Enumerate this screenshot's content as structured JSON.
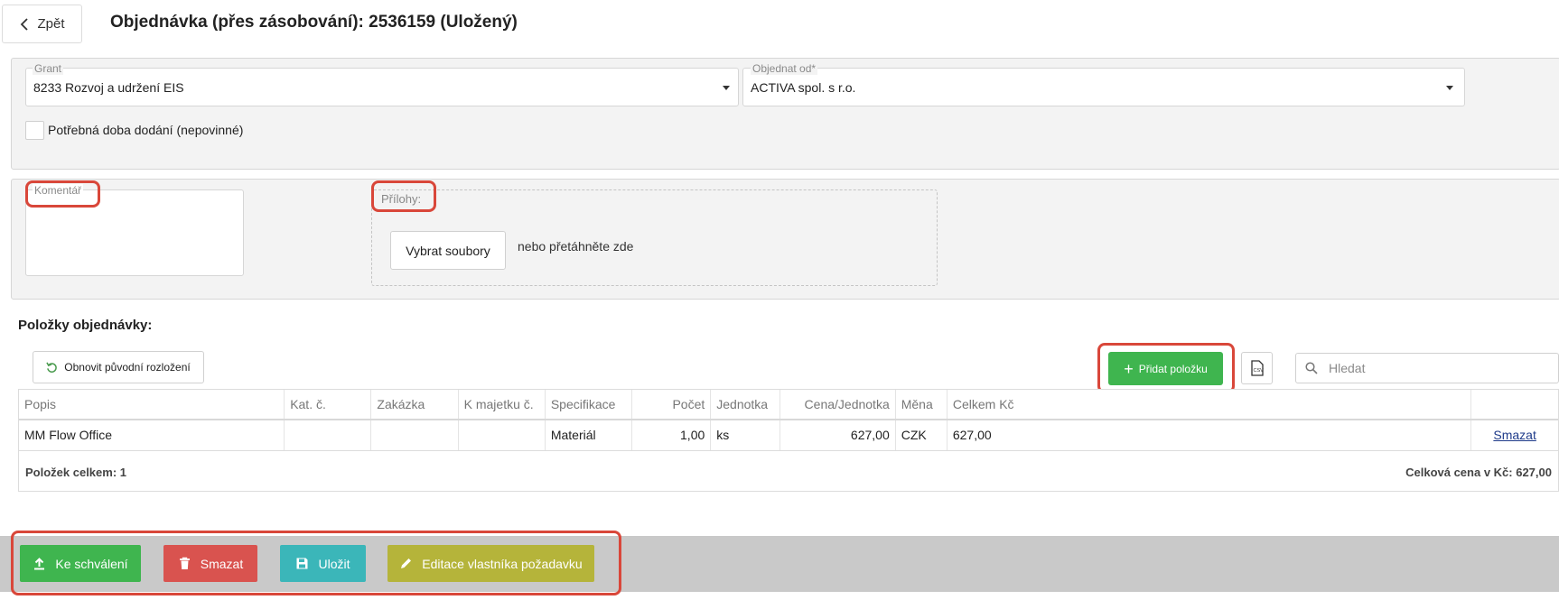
{
  "header": {
    "back_label": "Zpět",
    "title": "Objednávka (přes zásobování): 2536159 (Uložený)"
  },
  "order_form": {
    "grant": {
      "label": "Grant",
      "value": "8233 Rozvoj a udržení EIS"
    },
    "order_from": {
      "label": "Objednat od*",
      "value": "ACTIVA spol. s r.o."
    },
    "delivery_time_label": "Potřebná doba dodání (nepovinné)",
    "delivery_time_checked": false
  },
  "comment": {
    "label": "Komentář",
    "value": ""
  },
  "attachments": {
    "label": "Přílohy:",
    "select_button": "Vybrat soubory",
    "drop_hint": "nebo přetáhněte zde"
  },
  "items_section": {
    "title": "Položky objednávky:",
    "reset_layout_label": "Obnovit původní rozložení",
    "add_item_label": "Přidat položku",
    "csv_icon": "csv-export-icon",
    "search_placeholder": "Hledat",
    "columns": [
      "Popis",
      "Kat. č.",
      "Zakázka",
      "K majetku č.",
      "Specifikace",
      "Počet",
      "Jednotka",
      "Cena/Jednotka",
      "Měna",
      "Celkem Kč",
      ""
    ],
    "rows": [
      {
        "popis": "MM Flow Office",
        "kat_c": "",
        "zakazka": "",
        "k_majetku": "",
        "specifikace": "Materiál",
        "pocet": "1,00",
        "jednotka": "ks",
        "cena_jednotka": "627,00",
        "mena": "CZK",
        "celkem_kc": "627,00",
        "action": "Smazat"
      }
    ],
    "footer_count": "Položek celkem: 1",
    "footer_total": "Celková cena v Kč: 627,00"
  },
  "actions": {
    "submit_label": "Ke schválení",
    "delete_label": "Smazat",
    "save_label": "Uložit",
    "edit_owner_label": "Editace vlastníka požadavku"
  },
  "colors": {
    "submit": "#3fb54f",
    "delete": "#d9534f",
    "save": "#3bb6b9",
    "edit_owner": "#b5b43a",
    "highlight": "#d9473a",
    "bottom_bar": "#c9c9c9"
  }
}
